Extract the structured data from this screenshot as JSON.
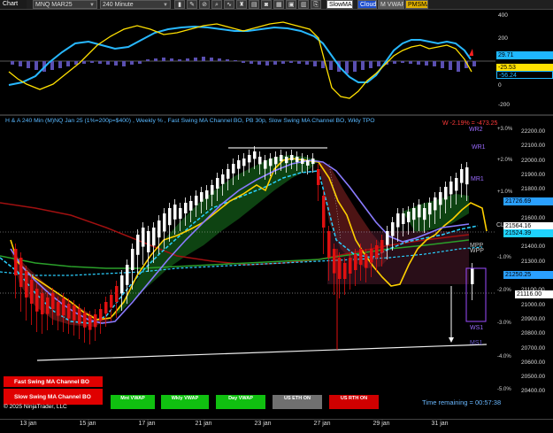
{
  "toolbar": {
    "chart_tab": "Chart",
    "instrument": "MNQ MAR25",
    "interval": "240 Minute",
    "indicator_tabs": [
      {
        "label": "SlowMA",
        "bg": "#ffffff",
        "fg": "#000000"
      },
      {
        "label": "Cloud",
        "bg": "#1e4fd0",
        "fg": "#ffffff"
      },
      {
        "label": "M VWAP",
        "bg": "#5a5a5a",
        "fg": "#dddddd"
      },
      {
        "label": "PMSMA",
        "bg": "#e0b000",
        "fg": "#000000"
      }
    ]
  },
  "oscillator": {
    "axis_labels": [
      "400",
      "200",
      "0",
      "-200"
    ],
    "value_tags": [
      {
        "text": "29.71",
        "bg": "#1fb7ff",
        "fg": "#000000"
      },
      {
        "text": "-25.53",
        "bg": "#ffe000",
        "fg": "#000000"
      },
      {
        "text": "-56.24",
        "bg": "#000000",
        "fg": "#1fb7ff"
      }
    ]
  },
  "main": {
    "title": "H & A 240 Min (M)NQ Jan 25  (1%=200p=$400) , Weekly % , Fast Swing MA Channel BO, PB 30p, Slow Swing MA Channel BO, Wkly TPO",
    "weekly_perf": "W -2.19% = -473.25",
    "price_axis": [
      "22200.00",
      "22100.00",
      "22000.00",
      "21900.00",
      "21800.00",
      "21700.00",
      "21600.00",
      "21500.00",
      "21400.00",
      "21300.00",
      "21200.00",
      "21100.00",
      "21000.00",
      "20900.00",
      "20800.00",
      "20700.00",
      "20600.00",
      "20500.00",
      "20400.00"
    ],
    "pct_axis": [
      "+3.0%",
      "+2.0%",
      "+1.0%",
      "-1.0%",
      "-2.0%",
      "-3.0%",
      "-4.0%",
      "-5.0%"
    ],
    "levels": [
      {
        "text": "WR2",
        "color": "#9b6bff"
      },
      {
        "text": "WR1",
        "color": "#9b6bff"
      },
      {
        "text": "MR1",
        "color": "#9b6bff"
      },
      {
        "text": "CLO",
        "color": "#cccccc"
      },
      {
        "text": "MPP",
        "color": "#cccccc"
      },
      {
        "text": "WPP",
        "color": "#cccccc"
      },
      {
        "text": "WS1",
        "color": "#9b6bff"
      },
      {
        "text": "MS1",
        "color": "#6a5acd"
      }
    ],
    "price_tags": [
      {
        "text": "21726.69",
        "bg": "#2aa0ff",
        "fg": "#000000"
      },
      {
        "text": "21564.16",
        "bg": "#ffffff",
        "fg": "#000000"
      },
      {
        "text": "21524.39",
        "bg": "#1fd3ff",
        "fg": "#000000"
      },
      {
        "text": "21250.25",
        "bg": "#2aa0ff",
        "fg": "#000000"
      },
      {
        "text": "21116.00",
        "bg": "#ffffff",
        "fg": "#000000"
      }
    ],
    "buttons": [
      {
        "label": "Fast Swing MA Channel BO",
        "bg": "#e00000",
        "fg": "#ffffff"
      },
      {
        "label": "Slow Swing MA Channel BO",
        "bg": "#e00000",
        "fg": "#ffffff"
      },
      {
        "label": "Mnt VWAP",
        "bg": "#10c010",
        "fg": "#ffffff"
      },
      {
        "label": "Wkly VWAP",
        "bg": "#10c010",
        "fg": "#ffffff"
      },
      {
        "label": "Day VWAP",
        "bg": "#10c010",
        "fg": "#ffffff"
      },
      {
        "label": "US ETH ON",
        "bg": "#707070",
        "fg": "#ffffff"
      },
      {
        "label": "US RTH ON",
        "bg": "#d00000",
        "fg": "#ffffff"
      }
    ],
    "time_remaining": "Time remaining = 00:57:38",
    "copyright": "© 2025 NinjaTrader, LLC"
  },
  "x_axis": [
    "13 jan",
    "15 jan",
    "17 jan",
    "21 jan",
    "23 jan",
    "27 jan",
    "29 jan",
    "31 jan"
  ]
}
